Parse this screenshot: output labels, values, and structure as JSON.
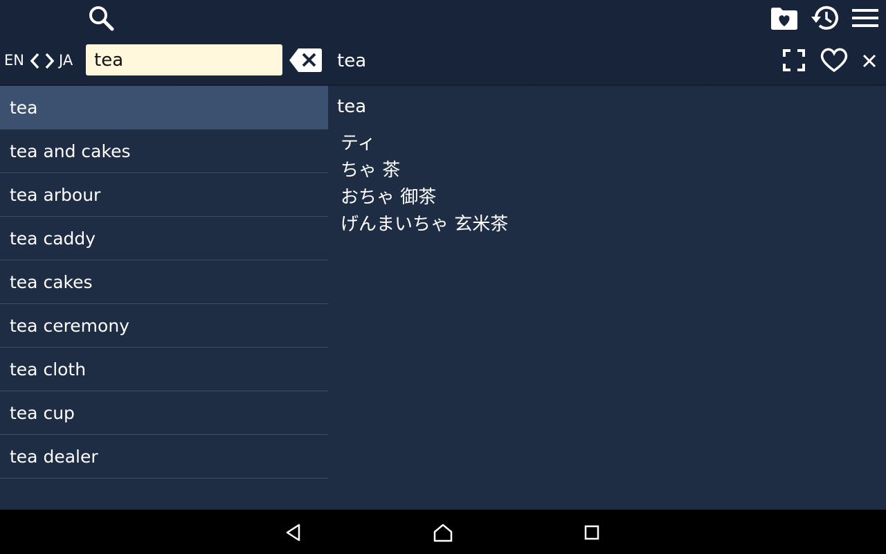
{
  "search": {
    "value": "tea"
  },
  "lang": {
    "from": "EN",
    "to": "JA"
  },
  "header": {
    "word": "tea"
  },
  "icons": {
    "search": "search-icon",
    "favorites_folder": "favorites-folder-icon",
    "history": "history-icon",
    "menu": "menu-icon",
    "clear": "backspace-clear-icon",
    "fullscreen": "fullscreen-icon",
    "favorite": "heart-icon",
    "close": "close-icon"
  },
  "word_list": [
    "tea",
    "tea and cakes",
    "tea arbour",
    "tea caddy",
    "tea cakes",
    "tea ceremony",
    "tea cloth",
    "tea cup",
    "tea dealer"
  ],
  "detail": {
    "word": "tea",
    "translations": [
      "ティ",
      "ちゃ 茶",
      "おちゃ 御茶",
      "げんまいちゃ 玄米茶"
    ]
  },
  "colors": {
    "background": "#1f2d44",
    "topbar": "#17243a",
    "selected_row": "#3c5070",
    "search_field": "#fff8dc"
  }
}
